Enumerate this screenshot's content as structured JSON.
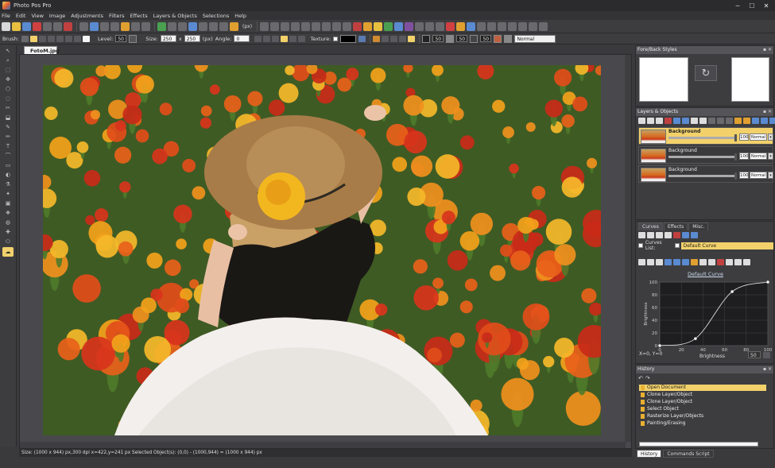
{
  "window": {
    "title": "Photo Pos Pro",
    "minimize": "─",
    "maximize": "☐",
    "close": "✕"
  },
  "menu": [
    "File",
    "Edit",
    "View",
    "Image",
    "Adjustments",
    "Filters",
    "Effects",
    "Layers & Objects",
    "Selections",
    "Help"
  ],
  "toolbar": {
    "zoom_unit": "(px)"
  },
  "options": {
    "brush_label": "Brush:",
    "level_label": "Level:",
    "level_value": "50",
    "size_label": "Size:",
    "size_value1": "250",
    "size_x": "x",
    "size_value2": "250",
    "size_unit": "(px)",
    "angle_label": "Angle:",
    "angle_value": "0",
    "texture_label": "Texture:",
    "mode_values": [
      "50",
      "50",
      "50"
    ],
    "blend_mode": "Normal"
  },
  "document": {
    "tab_label": "FotoM.jpg"
  },
  "status": {
    "text": "Size: (1000 x 944) px,300 dpi    x=422,y=241 px   Selected Object(s): (0,0) - (1000,944) = (1000 x 944) px"
  },
  "panels": {
    "fore_back": {
      "title": "Fore/Back Styles",
      "swap_icon": "↻"
    },
    "layers": {
      "title": "Layers & Objects",
      "rows": [
        {
          "name": "Background",
          "opacity": "100",
          "mode": "Normal",
          "selected": true
        },
        {
          "name": "Background",
          "opacity": "100",
          "mode": "Normal",
          "selected": false
        },
        {
          "name": "Background",
          "opacity": "100",
          "mode": "Normal",
          "selected": false
        }
      ]
    },
    "curves": {
      "tabs": [
        "Curves",
        "Effects",
        "Misc."
      ],
      "list_label": "Curves List:",
      "list_value": "Default Curve",
      "chart_title": "Default Curve",
      "y_axis_label": "Brightness",
      "x_axis_label": "Brightness",
      "coords": "X=0, Y=0",
      "value": "50",
      "ticks": [
        "0",
        "20",
        "40",
        "60",
        "80",
        "100"
      ]
    },
    "history": {
      "title": "History",
      "items": [
        {
          "label": "Open Document",
          "selected": true
        },
        {
          "label": "Clone Layer/Object",
          "selected": false
        },
        {
          "label": "Clone Layer/Object",
          "selected": false
        },
        {
          "label": "Select Object",
          "selected": false
        },
        {
          "label": "Rasterize Layer/Objects",
          "selected": false
        },
        {
          "label": "Painting/Erasing",
          "selected": false
        }
      ],
      "tabs": [
        "History",
        "Commands Script"
      ]
    }
  },
  "colors": {
    "accent": "#f2d16b",
    "background": "#3a3a3d",
    "panel_header": "#555559"
  },
  "chart_data": {
    "type": "line",
    "title": "Default Curve",
    "xlabel": "Brightness",
    "ylabel": "Brightness",
    "x": [
      0,
      33,
      67,
      100
    ],
    "y": [
      0,
      11,
      85,
      100
    ],
    "xlim": [
      0,
      100
    ],
    "ylim": [
      0,
      100
    ],
    "xticks": [
      0,
      20,
      40,
      60,
      80,
      100
    ],
    "yticks": [
      0,
      20,
      40,
      60,
      80,
      100
    ]
  }
}
